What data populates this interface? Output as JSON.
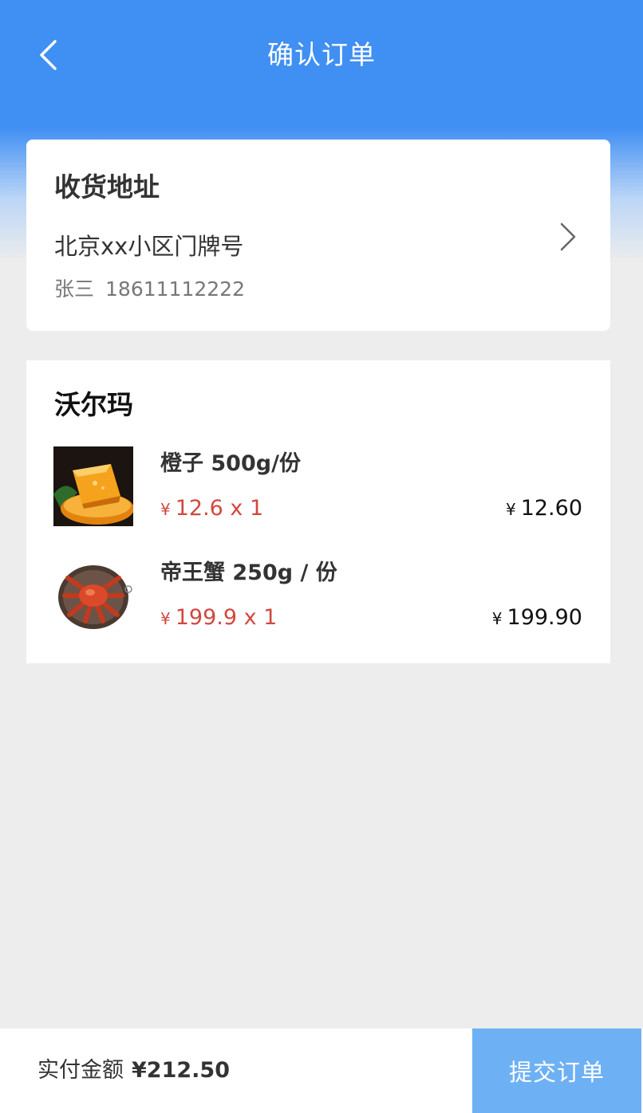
{
  "header": {
    "title": "确认订单",
    "back_icon": "chevron-left-icon"
  },
  "address": {
    "heading": "收货地址",
    "detail": "北京xx小区门牌号",
    "name": "张三",
    "phone": "18611112222",
    "arrow_icon": "chevron-right-icon"
  },
  "store": {
    "name": "沃尔玛",
    "items": [
      {
        "name": "橙子 500g/份",
        "currency": "¥",
        "unit_price": "12.6 x 1",
        "total": "12.60",
        "image_icon": "orange-image"
      },
      {
        "name": "帝王蟹 250g / 份",
        "currency": "¥",
        "unit_price": "199.9 x 1",
        "total": "199.90",
        "image_icon": "king-crab-image"
      }
    ]
  },
  "footer": {
    "paid_label": "实付金额",
    "paid_amount": "¥212.50",
    "submit_label": "提交订单"
  },
  "colors": {
    "header_blue": "#408ff3",
    "price_red": "#d2473f",
    "submit_button": "#6eb0f4",
    "background": "#ededed"
  }
}
